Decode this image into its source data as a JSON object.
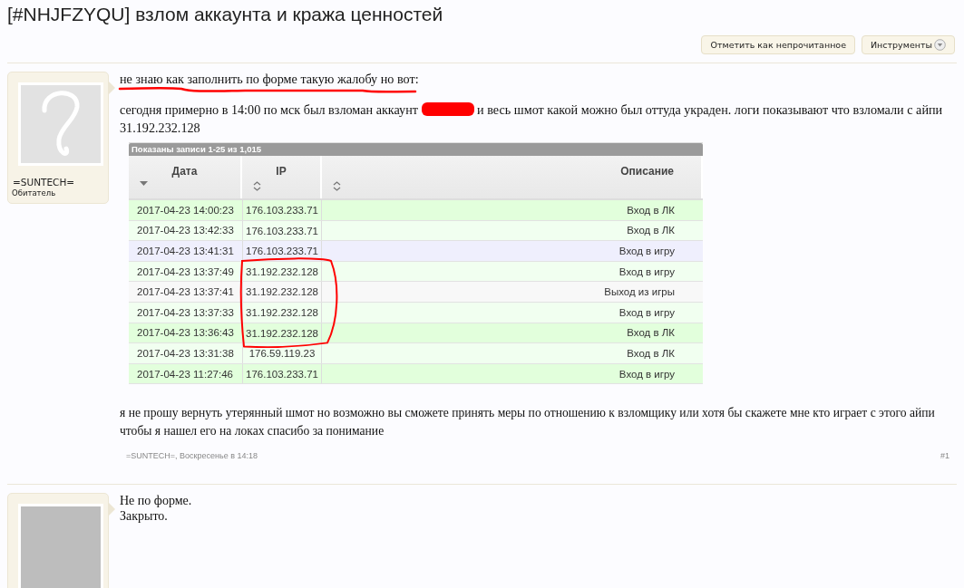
{
  "title": "[#NHJFZYQU] взлом аккаунта и кража ценностей",
  "toolbar": [
    {
      "label": "Отметить как непрочитанное",
      "kind": "plain"
    },
    {
      "label": "Инструменты",
      "kind": "menu"
    }
  ],
  "posts": [
    {
      "kind": "report",
      "author": {
        "name": "=SUNTECH=",
        "rank": "Обитатель"
      },
      "intro": {
        "text": "не знаю как заполнить по форме такую жалобу но вот:",
        "underlined": true
      },
      "text_before": "сегодня примерно в 14:00 по мск был взломан аккаунт",
      "redacted": true,
      "text_after": "и весь шмот какой можно был оттуда украден. логи показывают что взломали с айпи 31.192.232.128",
      "log": {
        "caption": "Показаны записи 1-25 из 1,015",
        "columns": [
          {
            "label": "Дата",
            "kind": "sorted"
          },
          {
            "label": "IP",
            "kind": "sortable"
          },
          {
            "label": "Описание",
            "kind": "sortable"
          }
        ],
        "rows": [
          {
            "date": "2017-04-23 14:00:23",
            "ip": "176.103.233.71",
            "action": "Вход в ЛК",
            "color": "#e2ffdc",
            "circled": false
          },
          {
            "date": "2017-04-23 13:42:33",
            "ip": "176.103.233.71",
            "action": "Вход в ЛК",
            "color": "#f1fff0",
            "circled": false
          },
          {
            "date": "2017-04-23 13:41:31",
            "ip": "176.103.233.71",
            "action": "Вход в игру",
            "color": "#efeffd",
            "circled": false
          },
          {
            "date": "2017-04-23 13:37:49",
            "ip": "31.192.232.128",
            "action": "Вход в игру",
            "color": "#f1fff0",
            "circled": true
          },
          {
            "date": "2017-04-23 13:37:41",
            "ip": "31.192.232.128",
            "action": "Выход из игры",
            "color": "#f8f8f8",
            "circled": true
          },
          {
            "date": "2017-04-23 13:37:33",
            "ip": "31.192.232.128",
            "action": "Вход в игру",
            "color": "#f1fff0",
            "circled": true
          },
          {
            "date": "2017-04-23 13:36:43",
            "ip": "31.192.232.128",
            "action": "Вход в ЛК",
            "color": "#e2ffdc",
            "circled": true
          },
          {
            "date": "2017-04-23 13:31:38",
            "ip": "176.59.119.23",
            "action": "Вход в ЛК",
            "color": "#f1fff0",
            "circled": false
          },
          {
            "date": "2017-04-23 11:27:46",
            "ip": "176.103.233.71",
            "action": "Вход в игру",
            "color": "#e2ffdc",
            "circled": false
          }
        ]
      },
      "closing": "я не прошу вернуть утерянный шмот но возможно вы сможете принять меры по отношению к взломщику или хотя бы скажете мне кто играет с этого айпи чтобы я нашел его на локах спасибо за понимание",
      "meta": "=SUNTECH=, Воскресенье в 14:18",
      "number": "#1"
    },
    {
      "kind": "reply",
      "lines": [
        "Не по форме.",
        "Закрыто."
      ]
    }
  ]
}
